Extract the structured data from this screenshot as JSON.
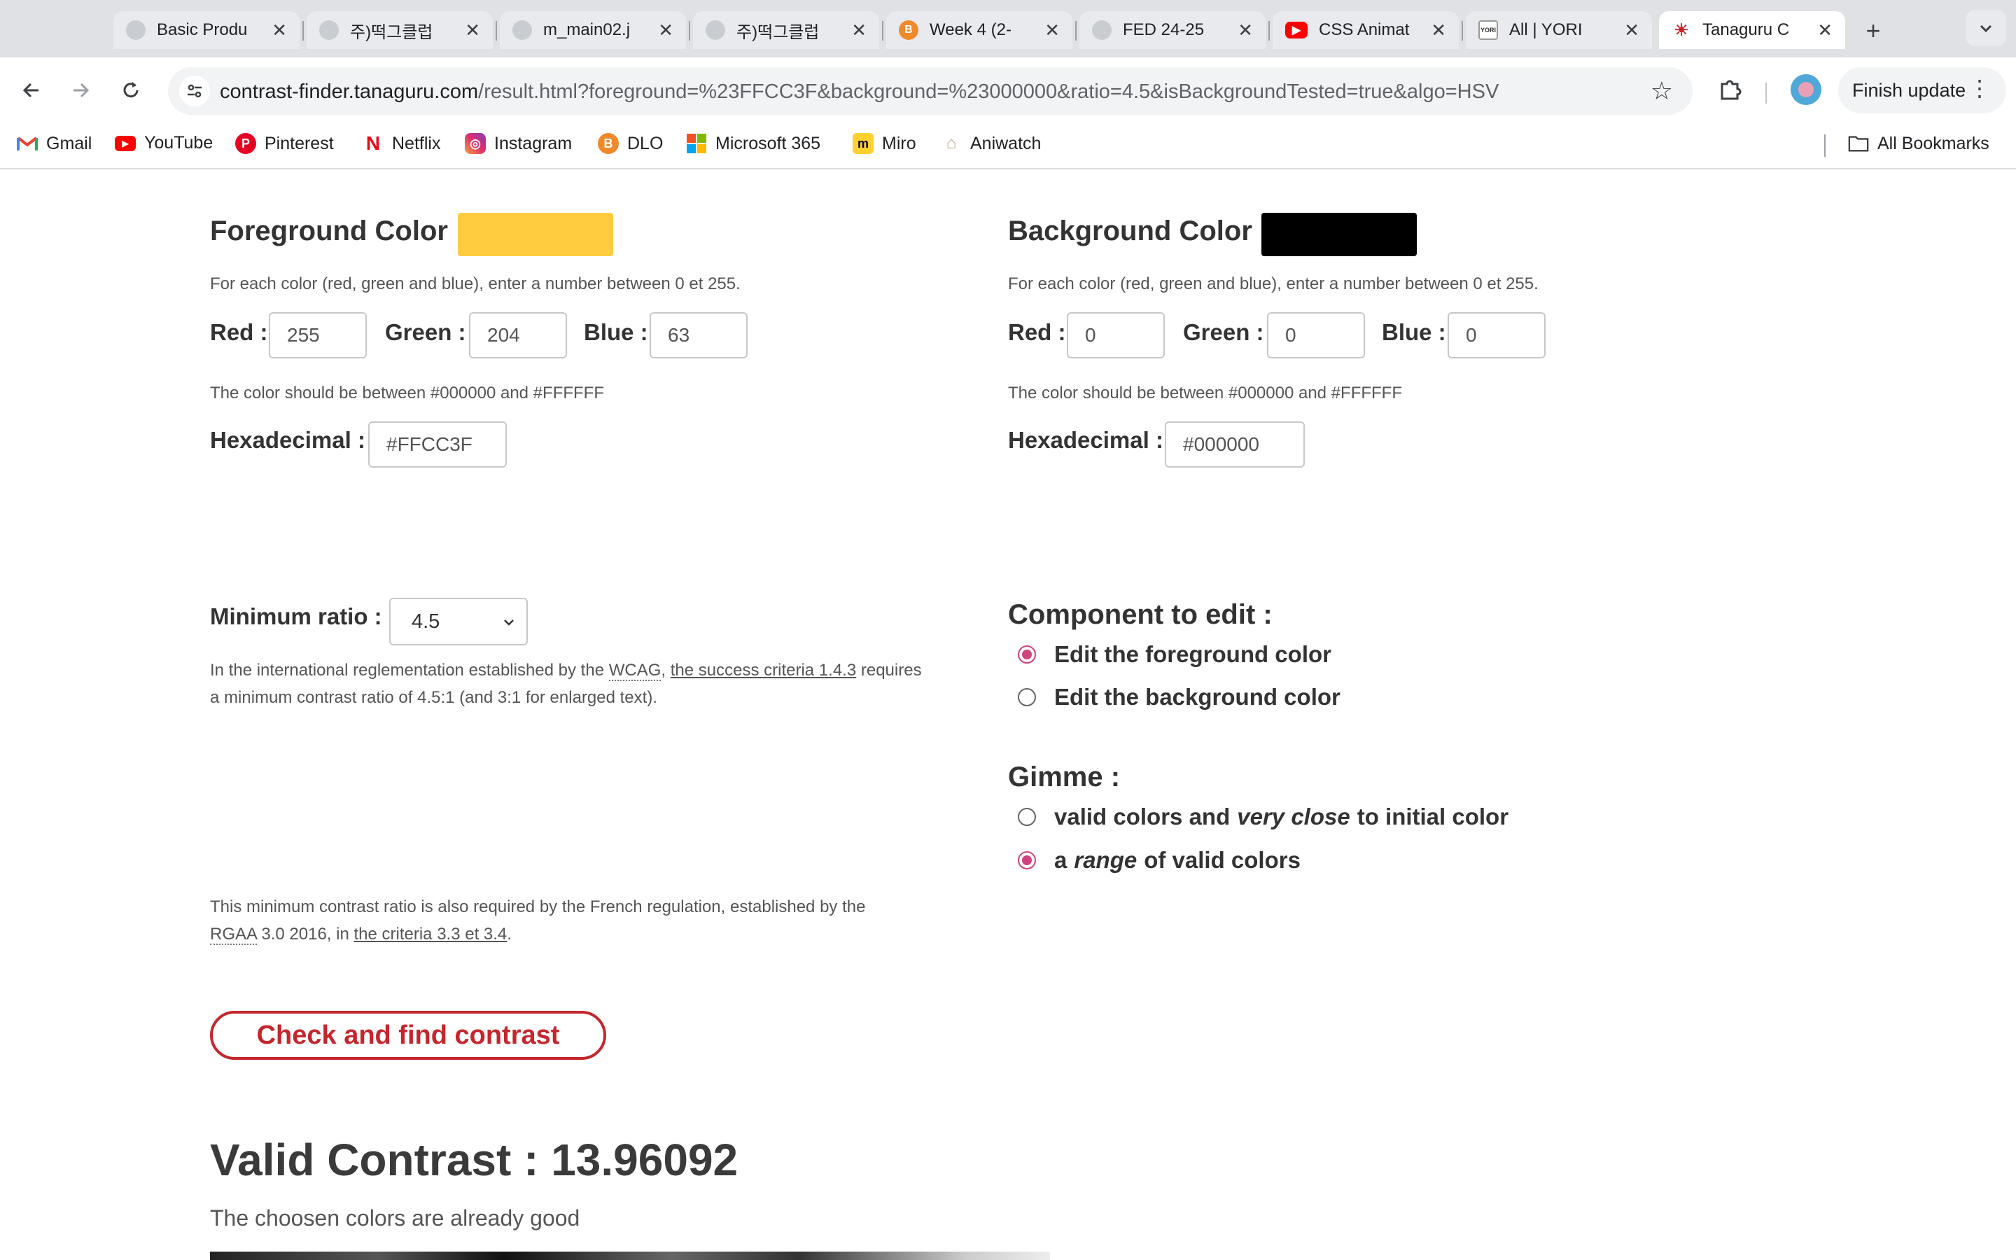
{
  "browser": {
    "tabs": [
      {
        "title": "Basic Produ",
        "favicon": "globe"
      },
      {
        "title": "주)떡그클럽",
        "favicon": "globe"
      },
      {
        "title": "m_main02.j",
        "favicon": "globe"
      },
      {
        "title": "주)떡그클럽",
        "favicon": "globe"
      },
      {
        "title": "Week 4 (2-",
        "favicon": "b-orange"
      },
      {
        "title": "FED 24-25",
        "favicon": "globe"
      },
      {
        "title": "CSS Animat",
        "favicon": "youtube"
      },
      {
        "title": "All | YORI",
        "favicon": "yori"
      },
      {
        "title": "Tanaguru C",
        "favicon": "tanaguru"
      }
    ],
    "url_host": "contrast-finder.tanaguru.com",
    "url_path": "/result.html?foreground=%23FFCC3F&background=%23000000&ratio=4.5&isBackgroundTested=true&algo=HSV",
    "finish_update_label": "Finish update",
    "bookmarks": [
      {
        "label": "Gmail",
        "icon": "gmail-icon"
      },
      {
        "label": "YouTube",
        "icon": "youtube-icon"
      },
      {
        "label": "Pinterest",
        "icon": "pinterest-icon"
      },
      {
        "label": "Netflix",
        "icon": "netflix-icon"
      },
      {
        "label": "Instagram",
        "icon": "instagram-icon"
      },
      {
        "label": "DLO",
        "icon": "dlo-icon"
      },
      {
        "label": "Microsoft 365",
        "icon": "microsoft-icon"
      },
      {
        "label": "Miro",
        "icon": "miro-icon"
      },
      {
        "label": "Aniwatch",
        "icon": "aniwatch-icon"
      }
    ],
    "all_bookmarks_label": "All Bookmarks"
  },
  "foreground": {
    "title": "Foreground Color :",
    "swatch_color": "#FFCC3F",
    "help_rgb": "For each color (red, green and blue), enter a number between 0 et 255.",
    "red_label": "Red :",
    "red_value": "255",
    "green_label": "Green :",
    "green_value": "204",
    "blue_label": "Blue :",
    "blue_value": "63",
    "help_hex": "The color should be between #000000 and #FFFFFF",
    "hex_label": "Hexadecimal :",
    "hex_value": "#FFCC3F"
  },
  "background": {
    "title": "Background Color :",
    "swatch_color": "#000000",
    "help_rgb": "For each color (red, green and blue), enter a number between 0 et 255.",
    "red_label": "Red :",
    "red_value": "0",
    "green_label": "Green :",
    "green_value": "0",
    "blue_label": "Blue :",
    "blue_value": "0",
    "help_hex": "The color should be between #000000 and #FFFFFF",
    "hex_label": "Hexadecimal :",
    "hex_value": "#000000"
  },
  "ratio": {
    "label": "Minimum ratio :",
    "selected": "4.5",
    "p1_pre": "In the international reglementation established by the ",
    "p1_wcag": "WCAG",
    "p1_comma": ", ",
    "p1_link": "the success criteria 1.4.3",
    "p1_post": " requires",
    "p1_line2": "a minimum contrast ratio of 4.5:1 (and 3:1 for enlarged text).",
    "p2_line1": "This minimum contrast ratio is also required by the French regulation, established by the",
    "p2_rgaa": "RGAA",
    "p2_mid": " 3.0 2016, in ",
    "p2_link": "the criteria 3.3 et 3.4",
    "p2_end": "."
  },
  "component": {
    "title": "Component to edit :",
    "opt_fg": "Edit the foreground color",
    "opt_bg": "Edit the background color",
    "selected": "foreground"
  },
  "gimme": {
    "title": "Gimme :",
    "opt1_a": "valid colors and",
    "opt1_em": "very close",
    "opt1_b": "to initial color",
    "opt2_a": "a",
    "opt2_em": "range",
    "opt2_b": "of valid colors",
    "selected": "range"
  },
  "cta_label": "Check and find contrast",
  "result": {
    "title": "Valid Contrast : 13.96092",
    "subtitle": "The choosen colors are already good"
  },
  "colors": {
    "accent_radio": "#d0437d",
    "cta": "#c4262c"
  }
}
